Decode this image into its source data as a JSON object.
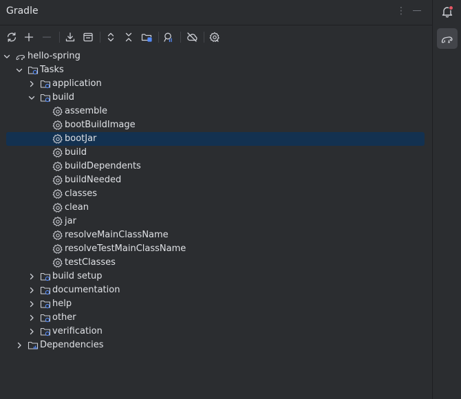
{
  "panel": {
    "title": "Gradle"
  },
  "toolbar": {
    "buttons": [
      {
        "name": "reload-all-gradle-projects-button",
        "icon": "refresh-icon"
      },
      {
        "name": "link-gradle-project-button",
        "icon": "plus-icon"
      },
      {
        "name": "unlink-gradle-project-button",
        "icon": "minus-icon"
      },
      {
        "name": "download-sources-button",
        "icon": "download-icon"
      },
      {
        "name": "execute-gradle-task-button",
        "icon": "terminal-icon"
      },
      {
        "name": "expand-all-button",
        "icon": "expand-all-icon"
      },
      {
        "name": "collapse-all-button",
        "icon": "collapse-all-icon"
      },
      {
        "name": "open-settings-file-button",
        "icon": "folder-settings-icon"
      },
      {
        "name": "analyze-dependencies-button",
        "icon": "analyze-icon"
      },
      {
        "name": "toggle-offline-mode-button",
        "icon": "cloud-off-icon"
      },
      {
        "name": "build-tool-settings-button",
        "icon": "settings-icon"
      }
    ]
  },
  "tree": {
    "selected": "bootJar",
    "items": [
      {
        "label": "hello-spring",
        "level": 0,
        "expanded": true,
        "icon": "gradle-elephant-icon"
      },
      {
        "label": "Tasks",
        "level": 1,
        "expanded": true,
        "icon": "task-folder-icon"
      },
      {
        "label": "application",
        "level": 2,
        "expanded": false,
        "icon": "task-folder-icon"
      },
      {
        "label": "build",
        "level": 2,
        "expanded": true,
        "icon": "task-folder-icon"
      },
      {
        "label": "assemble",
        "level": 3,
        "icon": "gear-icon"
      },
      {
        "label": "bootBuildImage",
        "level": 3,
        "icon": "gear-icon"
      },
      {
        "label": "bootJar",
        "level": 3,
        "icon": "gear-icon"
      },
      {
        "label": "build",
        "level": 3,
        "icon": "gear-icon"
      },
      {
        "label": "buildDependents",
        "level": 3,
        "icon": "gear-icon"
      },
      {
        "label": "buildNeeded",
        "level": 3,
        "icon": "gear-icon"
      },
      {
        "label": "classes",
        "level": 3,
        "icon": "gear-icon"
      },
      {
        "label": "clean",
        "level": 3,
        "icon": "gear-icon"
      },
      {
        "label": "jar",
        "level": 3,
        "icon": "gear-icon"
      },
      {
        "label": "resolveMainClassName",
        "level": 3,
        "icon": "gear-icon"
      },
      {
        "label": "resolveTestMainClassName",
        "level": 3,
        "icon": "gear-icon"
      },
      {
        "label": "testClasses",
        "level": 3,
        "icon": "gear-icon"
      },
      {
        "label": "build setup",
        "level": 2,
        "expanded": false,
        "icon": "task-folder-icon"
      },
      {
        "label": "documentation",
        "level": 2,
        "expanded": false,
        "icon": "task-folder-icon"
      },
      {
        "label": "help",
        "level": 2,
        "expanded": false,
        "icon": "task-folder-icon"
      },
      {
        "label": "other",
        "level": 2,
        "expanded": false,
        "icon": "task-folder-icon"
      },
      {
        "label": "verification",
        "level": 2,
        "expanded": false,
        "icon": "task-folder-icon"
      },
      {
        "label": "Dependencies",
        "level": 1,
        "expanded": false,
        "icon": "dependencies-folder-icon"
      }
    ]
  },
  "rightbar": {
    "buttons": [
      {
        "name": "notifications-button",
        "icon": "bell-icon",
        "badge": true
      },
      {
        "name": "gradle-tool-window-button",
        "icon": "gradle-elephant-icon",
        "active": true
      }
    ]
  },
  "colors": {
    "background": "#2b2d30",
    "text": "#dfe1e5",
    "icon": "#ced0d6",
    "selection": "#133150",
    "accent": "#548af7",
    "badge": "#e55765"
  }
}
